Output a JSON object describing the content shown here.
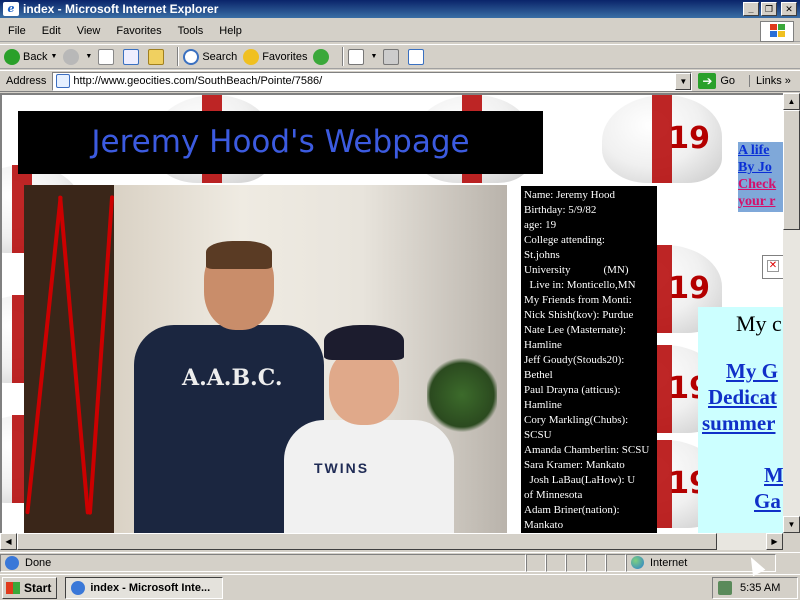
{
  "window": {
    "title": "index - Microsoft Internet Explorer",
    "controls": [
      "minimize",
      "restore",
      "close"
    ]
  },
  "menu": [
    "File",
    "Edit",
    "View",
    "Favorites",
    "Tools",
    "Help"
  ],
  "toolbar": {
    "back": "Back",
    "search": "Search",
    "favorites": "Favorites"
  },
  "address": {
    "label": "Address",
    "url": "http://www.geocities.com/SouthBeach/Pointe/7586/",
    "go": "Go",
    "links": "Links"
  },
  "page": {
    "banner_title": "Jeremy Hood's Webpage",
    "helmet_number": "19",
    "photo_shirt_text": "A.A.B.C.",
    "photo_shirt2_text": "TWINS",
    "info_lines": [
      "Name: Jeremy Hood",
      "Birthday: 5/9/82",
      "age: 19",
      "College attending:",
      "St.johns",
      "University            (MN)",
      "  Live in: Monticello,MN",
      "My Friends from Monti:",
      "Nick Shish(kov): Purdue",
      "Nate Lee (Masternate):",
      "Hamline",
      "Jeff Goudy(Stouds20):",
      "Bethel",
      "Paul Drayna (atticus):",
      "Hamline",
      "Cory Markling(Chubs):",
      "SCSU",
      "Amanda Chamberlin: SCSU",
      "Sara Kramer: Mankato",
      "  Josh LaBau(LaHow): U",
      "of Minnesota",
      "Adam Briner(nation):",
      "Mankato"
    ],
    "side_links": [
      {
        "text": "A life",
        "color": "blue"
      },
      {
        "text": "By Jo",
        "color": "blue"
      },
      {
        "text": "Check",
        "color": "red"
      },
      {
        "text": "your r",
        "color": "red"
      }
    ],
    "right_panel": {
      "heading": "My c",
      "links": [
        "My G",
        "Dedicat",
        "summer",
        "M",
        "Ga"
      ]
    }
  },
  "status": {
    "text": "Done",
    "zone": "Internet"
  },
  "taskbar": {
    "start": "Start",
    "task": "index - Microsoft Inte...",
    "time": "5:35 AM"
  },
  "colors": {
    "titlebar": "#0a246a",
    "banner_bg": "#000000",
    "banner_text": "#3c5be0",
    "right_panel_bg": "#ccffff",
    "link_blue": "#1030c8"
  }
}
